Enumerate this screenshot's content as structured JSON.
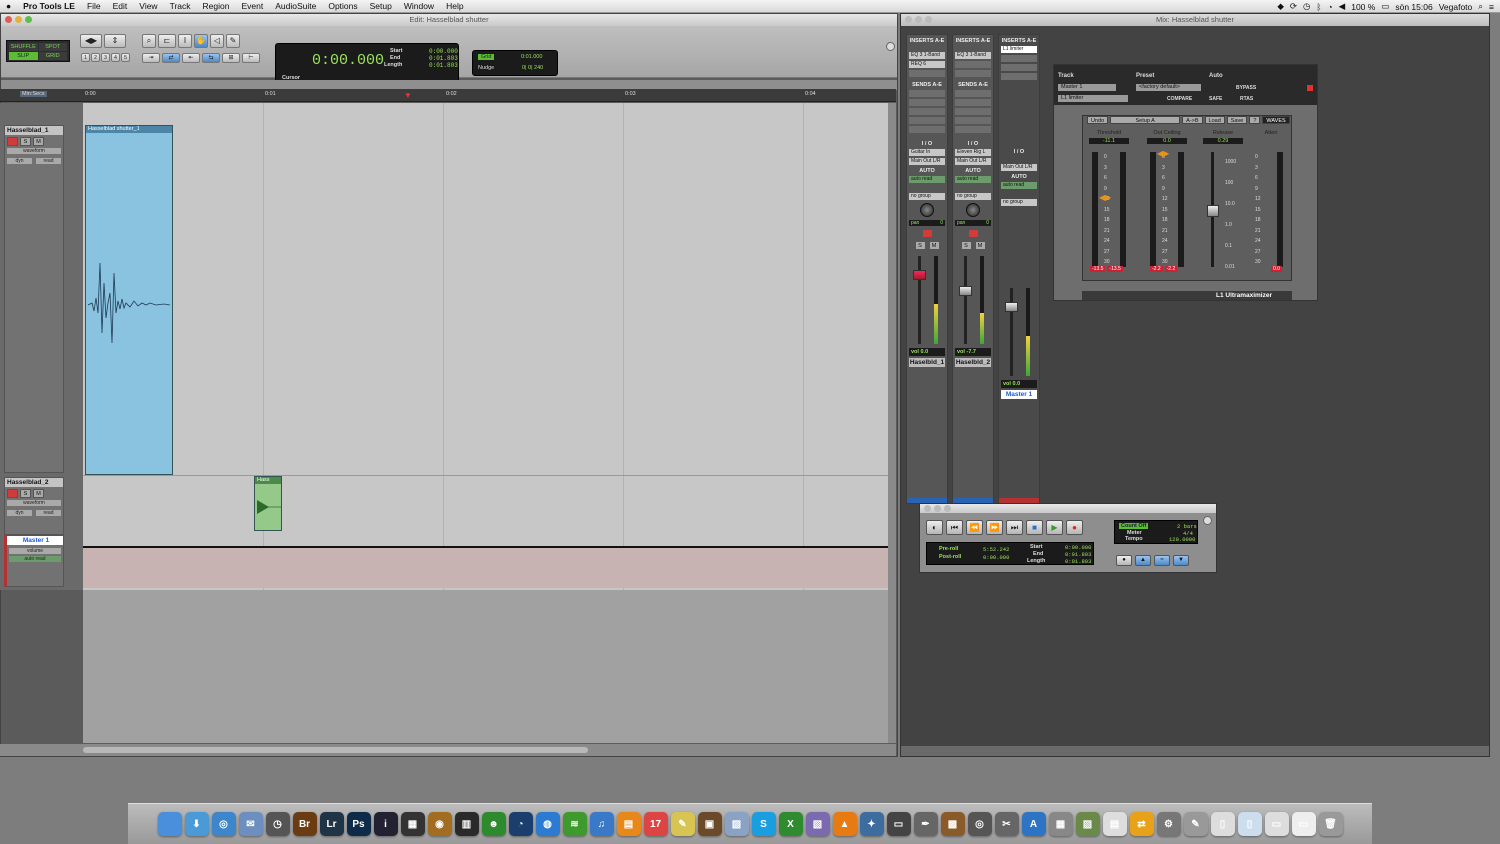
{
  "menubar": {
    "apple_icon": "apple-icon",
    "app": "Pro Tools LE",
    "items": [
      "File",
      "Edit",
      "View",
      "Track",
      "Region",
      "Event",
      "AudioSuite",
      "Options",
      "Setup",
      "Window",
      "Help"
    ],
    "battery": "100 %",
    "clock": "sön 15:06",
    "user": "Vegafoto"
  },
  "edit_window": {
    "title": "Edit: Hasselblad shutter",
    "modes": [
      "SHUFFLE",
      "SPOT",
      "SLIP",
      "GRID"
    ],
    "zoom_presets": [
      "1",
      "2",
      "3",
      "4",
      "5"
    ],
    "counter": {
      "main": "0:00.000",
      "cursor_label": "Cursor",
      "start_label": "Start",
      "end_label": "End",
      "length_label": "Length",
      "start": "0:00.000",
      "end": "0:01.803",
      "length": "0:01.803"
    },
    "grid": {
      "grid_label": "Grid",
      "grid_value": "0:01.000",
      "nudge_label": "Nudge",
      "nudge_value": "0| 0| 240"
    },
    "ruler": {
      "label": "Min:Secs",
      "ticks": [
        "0:00",
        "0:01",
        "0:02",
        "0:03",
        "0:04"
      ]
    },
    "tracks": [
      {
        "name": "Hasselblad_1",
        "view": "waveform",
        "auto1": "dyn",
        "auto2": "read"
      },
      {
        "name": "Hasselblad_2",
        "view": "waveform",
        "auto1": "dyn",
        "auto2": "read"
      },
      {
        "name": "Master 1",
        "view": "volume",
        "auto2": "auto read"
      }
    ],
    "regions": [
      {
        "name": "Hasselblad shutter_1"
      },
      {
        "name": "Hass"
      }
    ]
  },
  "mix_window": {
    "title": "Mix: Hasselblad shutter",
    "strips": [
      {
        "inserts_label": "INSERTS A-E",
        "inserts": [
          "EQ 3 1-Band",
          "REQ 6"
        ],
        "sends_label": "SENDS A-E",
        "io_label": "I / O",
        "input": "Guitar In",
        "output": "Main Out L/R",
        "auto_label": "AUTO",
        "auto": "auto read",
        "group": "no group",
        "pan_label": "pan",
        "pan_value": "0",
        "vol_label": "vol",
        "vol": "0.0",
        "name": "Haselbld_1",
        "color": "#2b63b4",
        "meter_level": 0.45
      },
      {
        "inserts_label": "INSERTS A-E",
        "inserts": [
          "EQ 3 1-Band"
        ],
        "sends_label": "SENDS A-E",
        "io_label": "I / O",
        "input": "Eleven Rig L",
        "output": "Main Out L/R",
        "auto_label": "AUTO",
        "auto": "auto read",
        "group": "no group",
        "pan_label": "pan",
        "pan_value": "0",
        "vol_label": "vol",
        "vol": "-7.7",
        "name": "Haselbld_2",
        "color": "#2b63b4",
        "meter_level": 0.35
      },
      {
        "inserts_label": "INSERTS A-E",
        "inserts": [
          "L1 limiter"
        ],
        "io_label": "I / O",
        "output": "Main Out L/R",
        "auto_label": "AUTO",
        "auto": "auto read",
        "group": "no group",
        "vol_label": "vol",
        "vol": "0.0",
        "name": "Master 1",
        "color": "#b53232",
        "meter_level": 0.45
      }
    ]
  },
  "plugin": {
    "title": "Mix: Hasselblad shutter",
    "track_label": "Track",
    "preset_label": "Preset",
    "auto_label": "Auto",
    "track": "Master 1",
    "insert": "L1 limiter",
    "preset": "<factory default>",
    "compare": "COMPARE",
    "bypass": "BYPASS",
    "safe": "SAFE",
    "rtas": "RTAS",
    "toolbar": [
      "Undo",
      "Setup A",
      "A->B",
      "Load",
      "Save",
      "?"
    ],
    "brand": "WAVES",
    "columns": [
      {
        "name": "Threshold",
        "readout": "-11.1"
      },
      {
        "name": "Out Ceiling",
        "readout": "0.0"
      },
      {
        "name": "Release",
        "readout": "0.29"
      },
      {
        "name": "Atten",
        "readout": ""
      }
    ],
    "scale": [
      "0",
      "3",
      "6",
      "9",
      "12",
      "15",
      "18",
      "21",
      "24",
      "27",
      "30"
    ],
    "release_scale": [
      "1000",
      "100",
      "10.0",
      "1.0",
      "0.1",
      "0.01"
    ],
    "peak_readouts": [
      "-13.5",
      "-13.5",
      "-2.2",
      "-2.2",
      "0.0"
    ],
    "name": "L1 Ultramaximizer"
  },
  "transport": {
    "preroll_label": "Pre-roll",
    "postroll_label": "Post-roll",
    "preroll": "5:52.242",
    "postroll": "0:00.000",
    "start_label": "Start",
    "end_label": "End",
    "length_label": "Length",
    "start": "0:00.000",
    "end": "0:01.803",
    "length": "0:01.803",
    "countoff": "Count Off",
    "bars": "2 bars",
    "meter_label": "Meter",
    "meter": "4/4",
    "tempo_label": "Tempo",
    "tempo": "120.0000"
  },
  "dock": {
    "icons": [
      {
        "name": "finder-icon",
        "glyph": "",
        "color": "#4a8fdc"
      },
      {
        "name": "downloads-icon",
        "glyph": "⬇",
        "color": "#4a9ad6"
      },
      {
        "name": "safari-icon",
        "glyph": "◎",
        "color": "#3d86cc"
      },
      {
        "name": "mail-icon",
        "glyph": "✉",
        "color": "#6c8fbf"
      },
      {
        "name": "time-machine-icon",
        "glyph": "◷",
        "color": "#555"
      },
      {
        "name": "bridge-icon",
        "glyph": "Br",
        "color": "#6b3b12"
      },
      {
        "name": "lightroom-icon",
        "glyph": "Lr",
        "color": "#1f3446"
      },
      {
        "name": "photoshop-icon",
        "glyph": "Ps",
        "color": "#0f2b4a"
      },
      {
        "name": "info-icon",
        "glyph": "i",
        "color": "#223"
      },
      {
        "name": "clapper-icon",
        "glyph": "▦",
        "color": "#333"
      },
      {
        "name": "aperture-icon",
        "glyph": "◉",
        "color": "#a26d21"
      },
      {
        "name": "final-cut-icon",
        "glyph": "▥",
        "color": "#2a2a2a"
      },
      {
        "name": "alien-icon",
        "glyph": "☻",
        "color": "#2d8a2d"
      },
      {
        "name": "wifi-icon",
        "glyph": "◔",
        "color": "#1c3e6e"
      },
      {
        "name": "browser-icon",
        "glyph": "◍",
        "color": "#2a7bd1"
      },
      {
        "name": "spotify-icon",
        "glyph": "≋",
        "color": "#3e9a2c"
      },
      {
        "name": "itunes-icon",
        "glyph": "♫",
        "color": "#3a78c8"
      },
      {
        "name": "ibooks-icon",
        "glyph": "▤",
        "color": "#e8871a"
      },
      {
        "name": "calendar-icon",
        "glyph": "17",
        "color": "#d44"
      },
      {
        "name": "notes-icon",
        "glyph": "✎",
        "color": "#d8c452"
      },
      {
        "name": "photos-icon",
        "glyph": "▣",
        "color": "#6b4a2a"
      },
      {
        "name": "preview-icon",
        "glyph": "▨",
        "color": "#8aa3c4"
      },
      {
        "name": "skype-icon",
        "glyph": "S",
        "color": "#1a9ee0"
      },
      {
        "name": "excel-icon",
        "glyph": "X",
        "color": "#2e8b2e"
      },
      {
        "name": "stack-icon",
        "glyph": "▧",
        "color": "#7b6ab0"
      },
      {
        "name": "vlc-icon",
        "glyph": "▲",
        "color": "#e87a12"
      },
      {
        "name": "evernote-icon",
        "glyph": "✦",
        "color": "#3d6d9e"
      },
      {
        "name": "terminal-icon",
        "glyph": "▭",
        "color": "#444"
      },
      {
        "name": "sketch-icon",
        "glyph": "✒",
        "color": "#666"
      },
      {
        "name": "keynote-icon",
        "glyph": "▩",
        "color": "#8a5a2a"
      },
      {
        "name": "disk-icon",
        "glyph": "◎",
        "color": "#555"
      },
      {
        "name": "tools-icon",
        "glyph": "✂",
        "color": "#666"
      },
      {
        "name": "appstore-icon",
        "glyph": "A",
        "color": "#2d74c4"
      },
      {
        "name": "grid-icon",
        "glyph": "▦",
        "color": "#888"
      },
      {
        "name": "image-icon",
        "glyph": "▨",
        "color": "#6a8a4a"
      },
      {
        "name": "script-icon",
        "glyph": "▤",
        "color": "#ddd"
      },
      {
        "name": "transmit-icon",
        "glyph": "⇄",
        "color": "#e8a21a"
      },
      {
        "name": "utility-icon",
        "glyph": "⚙",
        "color": "#777"
      },
      {
        "name": "pen-icon",
        "glyph": "✎",
        "color": "#999"
      },
      {
        "name": "doc-icon",
        "glyph": "▯",
        "color": "#ddd"
      },
      {
        "name": "pdf-icon",
        "glyph": "▯",
        "color": "#cde"
      },
      {
        "name": "window-icon",
        "glyph": "▭",
        "color": "#ddd"
      },
      {
        "name": "display-icon",
        "glyph": "▭",
        "color": "#eee"
      },
      {
        "name": "trash-icon",
        "glyph": "🗑",
        "color": "#999"
      }
    ]
  }
}
